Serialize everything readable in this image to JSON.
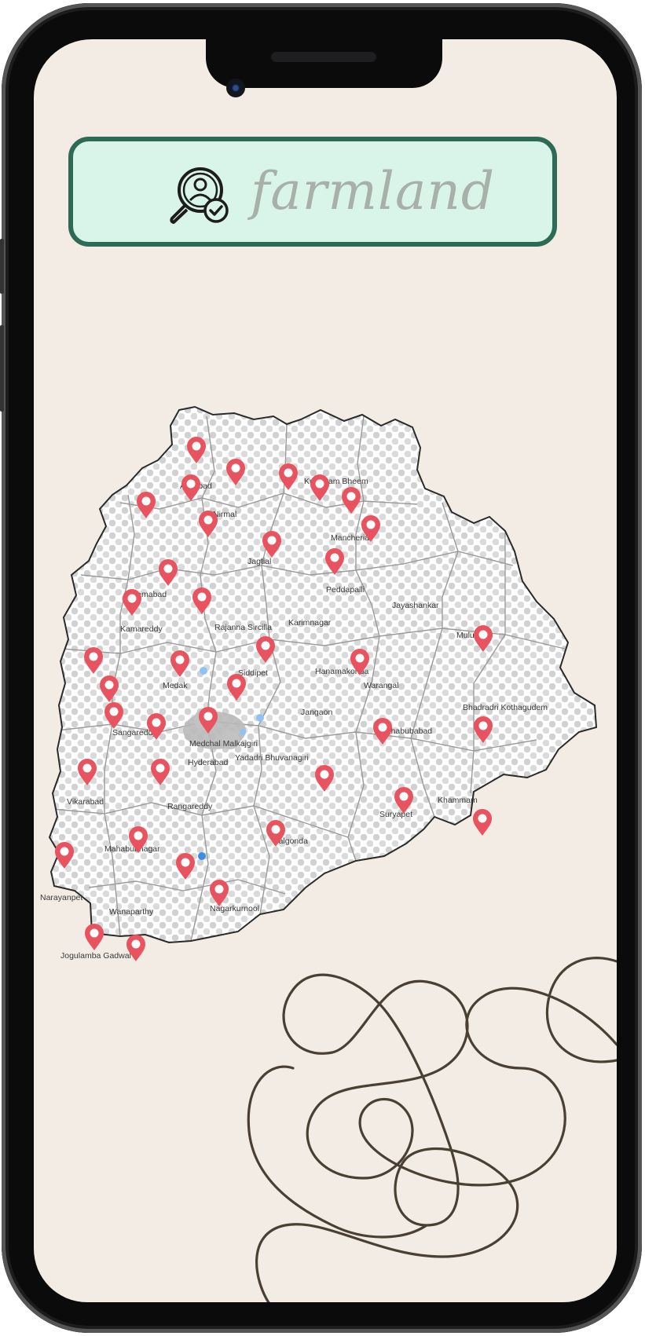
{
  "search": {
    "value": "farmland",
    "icon": "search-user-check-icon"
  },
  "map": {
    "region": "Telangana",
    "pin_color": "#e9525f",
    "districts": [
      "Adilabad",
      "Kumuram Bheem",
      "Nirmal",
      "Mancherial",
      "Jagtial",
      "Peddapalli",
      "Jayashankar",
      "Nizamabad",
      "Kamareddy",
      "Rajanna Sircilla",
      "Karimnagar",
      "Mulugu",
      "Hanamakonda",
      "Warangal",
      "Medak",
      "Siddipet",
      "Jangaon",
      "Mahabubabad",
      "Bhadradri Kothagudem",
      "Sangareddy",
      "Medchal Malkajgiri",
      "Hyderabad",
      "Yadadri Bhuvanagiri",
      "Vikarabad",
      "Rangareddy",
      "Suryapet",
      "Khammam",
      "Nalgonda",
      "Mahabubnagar",
      "Narayanpet",
      "Wanaparthy",
      "Nagarkurnool",
      "Jogulamba Gadwal"
    ]
  },
  "colors": {
    "screen_bg": "#f2ece5",
    "search_border": "#2e6b57",
    "search_bg": "#d9f5ea",
    "squiggle": "#4a3f33"
  }
}
